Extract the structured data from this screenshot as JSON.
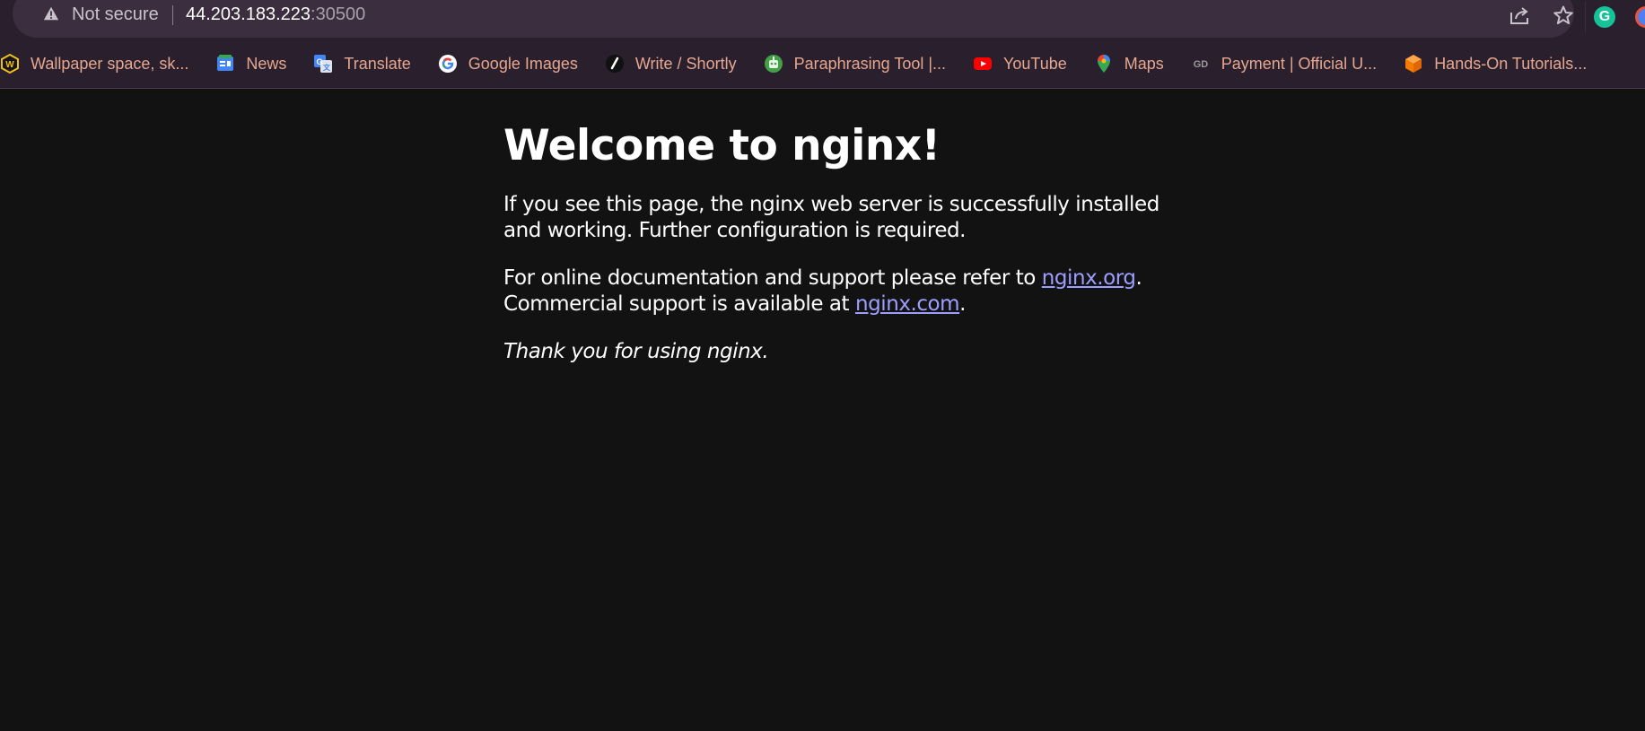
{
  "browser": {
    "security_label": "Not secure",
    "url_host": "44.203.183.223",
    "url_port": ":30500",
    "icons": {
      "warning": "warning-triangle-icon",
      "share": "share-icon",
      "bookmark": "star-icon",
      "extension": "grammarly-icon"
    },
    "extension_letter": "G"
  },
  "bookmarks": [
    {
      "label": "Wallpaper space, sk...",
      "icon": "wallpaper-icon"
    },
    {
      "label": "News",
      "icon": "google-news-icon"
    },
    {
      "label": "Translate",
      "icon": "google-translate-icon"
    },
    {
      "label": "Google Images",
      "icon": "google-icon"
    },
    {
      "label": "Write / Shortly",
      "icon": "shortly-icon"
    },
    {
      "label": "Paraphrasing Tool |...",
      "icon": "robot-icon"
    },
    {
      "label": "YouTube",
      "icon": "youtube-icon"
    },
    {
      "label": "Maps",
      "icon": "maps-pin-icon"
    },
    {
      "label": "Payment | Official U...",
      "icon": "gd-icon"
    },
    {
      "label": "Hands-On Tutorials...",
      "icon": "cube-icon"
    }
  ],
  "page": {
    "heading": "Welcome to nginx!",
    "intro": "If you see this page, the nginx web server is successfully installed and working. Further configuration is required.",
    "docs_prefix": "For online documentation and support please refer to ",
    "docs_link": "nginx.org",
    "docs_suffix": ".",
    "commercial_prefix": "Commercial support is available at ",
    "commercial_link": "nginx.com",
    "commercial_suffix": ".",
    "thanks": "Thank you for using nginx."
  },
  "colors": {
    "page_background": "#121212",
    "chrome_background": "#2a1f2d",
    "bookmark_text": "#e5a78f",
    "link": "#9e9eff"
  }
}
